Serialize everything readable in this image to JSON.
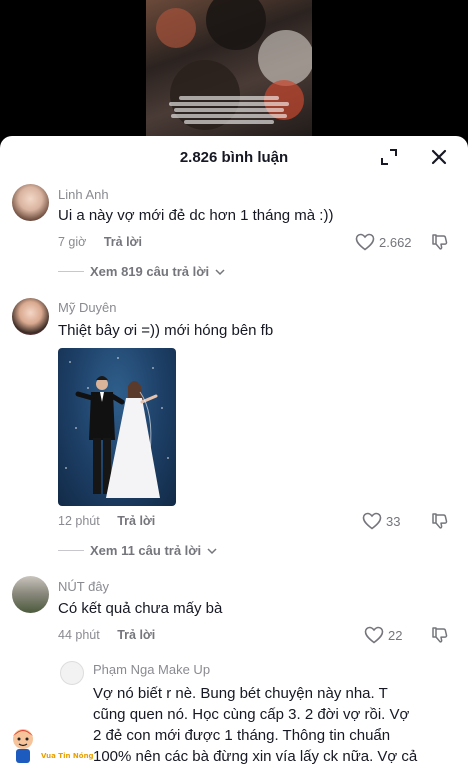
{
  "header": {
    "title": "2.826 bình luận"
  },
  "comments": [
    {
      "username": "Linh Anh",
      "text": "Ui a này vợ mới đẻ dc hơn 1 tháng mà :))",
      "time": "7 giờ",
      "reply_label": "Trả lời",
      "likes": "2.662",
      "view_replies": "Xem 819 câu trả lời"
    },
    {
      "username": "Mỹ Duyên",
      "text": "Thiệt bây ơi =)) mới hóng bên fb",
      "time": "12 phút",
      "reply_label": "Trả lời",
      "likes": "33",
      "view_replies": "Xem 11 câu trả lời"
    },
    {
      "username": "NÚT đây",
      "text": "Có kết quả chưa mấy bà",
      "time": "44 phút",
      "reply_label": "Trả lời",
      "likes": "22"
    }
  ],
  "reply": {
    "username": "Phạm Nga Make Up",
    "lines": [
      "Vợ nó biết r nè. Bung bét chuyện này nha. T",
      "cũng quen nó. Học cùng cấp 3. 2 đời vợ rồi. Vợ",
      "2 đẻ con mới được 1 tháng. Thông tin chuẩn",
      "100% nên các bà đừng xin vía lấy ck nữa. Vợ cả"
    ]
  },
  "watermark": {
    "text": "Vua Tin Nóng"
  },
  "colors": {
    "text": "#161823",
    "muted": "#8a8b91",
    "accent": "#e8a000"
  },
  "icons": [
    "expand-icon",
    "close-icon",
    "heart-icon",
    "dislike-icon",
    "chevron-down-icon"
  ]
}
